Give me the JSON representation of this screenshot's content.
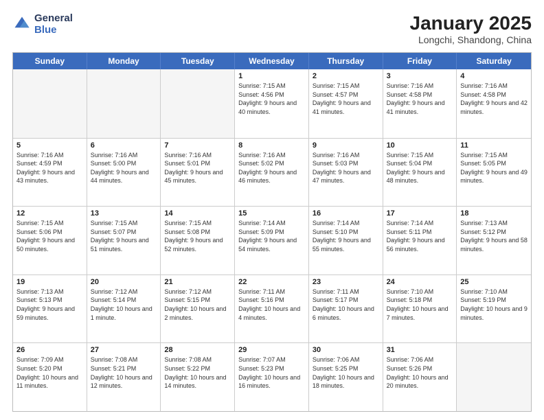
{
  "logo": {
    "line1": "General",
    "line2": "Blue"
  },
  "title": "January 2025",
  "location": "Longchi, Shandong, China",
  "header_days": [
    "Sunday",
    "Monday",
    "Tuesday",
    "Wednesday",
    "Thursday",
    "Friday",
    "Saturday"
  ],
  "weeks": [
    [
      {
        "day": "",
        "sunrise": "",
        "sunset": "",
        "daylight": ""
      },
      {
        "day": "",
        "sunrise": "",
        "sunset": "",
        "daylight": ""
      },
      {
        "day": "",
        "sunrise": "",
        "sunset": "",
        "daylight": ""
      },
      {
        "day": "1",
        "sunrise": "Sunrise: 7:15 AM",
        "sunset": "Sunset: 4:56 PM",
        "daylight": "Daylight: 9 hours and 40 minutes."
      },
      {
        "day": "2",
        "sunrise": "Sunrise: 7:15 AM",
        "sunset": "Sunset: 4:57 PM",
        "daylight": "Daylight: 9 hours and 41 minutes."
      },
      {
        "day": "3",
        "sunrise": "Sunrise: 7:16 AM",
        "sunset": "Sunset: 4:58 PM",
        "daylight": "Daylight: 9 hours and 41 minutes."
      },
      {
        "day": "4",
        "sunrise": "Sunrise: 7:16 AM",
        "sunset": "Sunset: 4:58 PM",
        "daylight": "Daylight: 9 hours and 42 minutes."
      }
    ],
    [
      {
        "day": "5",
        "sunrise": "Sunrise: 7:16 AM",
        "sunset": "Sunset: 4:59 PM",
        "daylight": "Daylight: 9 hours and 43 minutes."
      },
      {
        "day": "6",
        "sunrise": "Sunrise: 7:16 AM",
        "sunset": "Sunset: 5:00 PM",
        "daylight": "Daylight: 9 hours and 44 minutes."
      },
      {
        "day": "7",
        "sunrise": "Sunrise: 7:16 AM",
        "sunset": "Sunset: 5:01 PM",
        "daylight": "Daylight: 9 hours and 45 minutes."
      },
      {
        "day": "8",
        "sunrise": "Sunrise: 7:16 AM",
        "sunset": "Sunset: 5:02 PM",
        "daylight": "Daylight: 9 hours and 46 minutes."
      },
      {
        "day": "9",
        "sunrise": "Sunrise: 7:16 AM",
        "sunset": "Sunset: 5:03 PM",
        "daylight": "Daylight: 9 hours and 47 minutes."
      },
      {
        "day": "10",
        "sunrise": "Sunrise: 7:15 AM",
        "sunset": "Sunset: 5:04 PM",
        "daylight": "Daylight: 9 hours and 48 minutes."
      },
      {
        "day": "11",
        "sunrise": "Sunrise: 7:15 AM",
        "sunset": "Sunset: 5:05 PM",
        "daylight": "Daylight: 9 hours and 49 minutes."
      }
    ],
    [
      {
        "day": "12",
        "sunrise": "Sunrise: 7:15 AM",
        "sunset": "Sunset: 5:06 PM",
        "daylight": "Daylight: 9 hours and 50 minutes."
      },
      {
        "day": "13",
        "sunrise": "Sunrise: 7:15 AM",
        "sunset": "Sunset: 5:07 PM",
        "daylight": "Daylight: 9 hours and 51 minutes."
      },
      {
        "day": "14",
        "sunrise": "Sunrise: 7:15 AM",
        "sunset": "Sunset: 5:08 PM",
        "daylight": "Daylight: 9 hours and 52 minutes."
      },
      {
        "day": "15",
        "sunrise": "Sunrise: 7:14 AM",
        "sunset": "Sunset: 5:09 PM",
        "daylight": "Daylight: 9 hours and 54 minutes."
      },
      {
        "day": "16",
        "sunrise": "Sunrise: 7:14 AM",
        "sunset": "Sunset: 5:10 PM",
        "daylight": "Daylight: 9 hours and 55 minutes."
      },
      {
        "day": "17",
        "sunrise": "Sunrise: 7:14 AM",
        "sunset": "Sunset: 5:11 PM",
        "daylight": "Daylight: 9 hours and 56 minutes."
      },
      {
        "day": "18",
        "sunrise": "Sunrise: 7:13 AM",
        "sunset": "Sunset: 5:12 PM",
        "daylight": "Daylight: 9 hours and 58 minutes."
      }
    ],
    [
      {
        "day": "19",
        "sunrise": "Sunrise: 7:13 AM",
        "sunset": "Sunset: 5:13 PM",
        "daylight": "Daylight: 9 hours and 59 minutes."
      },
      {
        "day": "20",
        "sunrise": "Sunrise: 7:12 AM",
        "sunset": "Sunset: 5:14 PM",
        "daylight": "Daylight: 10 hours and 1 minute."
      },
      {
        "day": "21",
        "sunrise": "Sunrise: 7:12 AM",
        "sunset": "Sunset: 5:15 PM",
        "daylight": "Daylight: 10 hours and 2 minutes."
      },
      {
        "day": "22",
        "sunrise": "Sunrise: 7:11 AM",
        "sunset": "Sunset: 5:16 PM",
        "daylight": "Daylight: 10 hours and 4 minutes."
      },
      {
        "day": "23",
        "sunrise": "Sunrise: 7:11 AM",
        "sunset": "Sunset: 5:17 PM",
        "daylight": "Daylight: 10 hours and 6 minutes."
      },
      {
        "day": "24",
        "sunrise": "Sunrise: 7:10 AM",
        "sunset": "Sunset: 5:18 PM",
        "daylight": "Daylight: 10 hours and 7 minutes."
      },
      {
        "day": "25",
        "sunrise": "Sunrise: 7:10 AM",
        "sunset": "Sunset: 5:19 PM",
        "daylight": "Daylight: 10 hours and 9 minutes."
      }
    ],
    [
      {
        "day": "26",
        "sunrise": "Sunrise: 7:09 AM",
        "sunset": "Sunset: 5:20 PM",
        "daylight": "Daylight: 10 hours and 11 minutes."
      },
      {
        "day": "27",
        "sunrise": "Sunrise: 7:08 AM",
        "sunset": "Sunset: 5:21 PM",
        "daylight": "Daylight: 10 hours and 12 minutes."
      },
      {
        "day": "28",
        "sunrise": "Sunrise: 7:08 AM",
        "sunset": "Sunset: 5:22 PM",
        "daylight": "Daylight: 10 hours and 14 minutes."
      },
      {
        "day": "29",
        "sunrise": "Sunrise: 7:07 AM",
        "sunset": "Sunset: 5:23 PM",
        "daylight": "Daylight: 10 hours and 16 minutes."
      },
      {
        "day": "30",
        "sunrise": "Sunrise: 7:06 AM",
        "sunset": "Sunset: 5:25 PM",
        "daylight": "Daylight: 10 hours and 18 minutes."
      },
      {
        "day": "31",
        "sunrise": "Sunrise: 7:06 AM",
        "sunset": "Sunset: 5:26 PM",
        "daylight": "Daylight: 10 hours and 20 minutes."
      },
      {
        "day": "",
        "sunrise": "",
        "sunset": "",
        "daylight": ""
      }
    ]
  ]
}
